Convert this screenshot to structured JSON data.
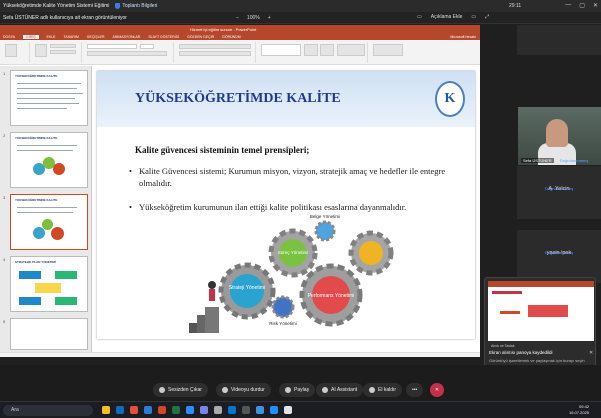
{
  "topbar": {
    "meeting_title": "Yükseköğretimde Kalite Yönetim Sistemi Eğitimi",
    "badge": "Toplantı Bilgileri",
    "clock": "29:11",
    "window_controls": [
      "—",
      "▢",
      "✕"
    ]
  },
  "sharebar": {
    "sharer": "Sefa ÜSTÜNER adlı kullanıcıya ait ekran görüntüleniyor",
    "zoom_minus": "−",
    "zoom_level": "100%",
    "zoom_plus": "+",
    "open_label": "Açıklama Ekle"
  },
  "powerpoint": {
    "window_title": "Hizmet içi eğitim sunum - PowerPoint",
    "tabs": [
      "DOSYA",
      "GİRİŞ",
      "EKLE",
      "TASARIM",
      "GEÇİŞLER",
      "ANİMASYONLAR",
      "SLAYT GÖSTERİSİ",
      "GÖZDEN GEÇİR",
      "GÖRÜNÜM"
    ],
    "user": "Microsoft hesabı"
  },
  "thumbnails": [
    {
      "num": "1",
      "title": "YÜKSEKÖĞRETİMDE KALİTE"
    },
    {
      "num": "2",
      "title": "YÜKSEKÖĞRETİMDE KALİTE"
    },
    {
      "num": "3",
      "title": "YÜKSEKÖĞRETİMDE KALİTE"
    },
    {
      "num": "4",
      "title": "STRATEJİK PLAN YÖNETİMİ"
    },
    {
      "num": "5",
      "title": ""
    }
  ],
  "slide": {
    "title": "YÜKSEKÖĞRETİMDE KALİTE",
    "logo_letter": "K",
    "subtitle": "Kalite güvencesi sisteminin temel prensipleri;",
    "bullet1": "Kalite Güvencesi sistemi; Kurumun misyon, vizyon, stratejik amaç ve hedefler ile entegre olmalıdır.",
    "bullet2": "Yükseköğretim kurumunun ilan ettiği kalite politikası esaslarına dayanmalıdır.",
    "gears": {
      "belge": "Belge Yönetimi",
      "surec": "Süreç Yönetimi",
      "strateji": "Strateji Yönetimi",
      "performans": "Performans Yönetimi",
      "risk": "Risk Yönetimi"
    }
  },
  "participants": {
    "webcam_name": "Sefa ÜSTÜNER",
    "webcam_status": "Doğrulanmamış",
    "tile1_name": "A. Yalcin",
    "tile1_status": "Doğrulanmamış",
    "tile2_name": "yasin ipek",
    "tile2_status": "Doğrulanmamış"
  },
  "popup": {
    "small": "Alıntı ve Taslak",
    "title": "Ekran alıntısı panoya kaydedildi",
    "body": "Görüntüyü işaretlemek ve paylaşmak için burayı seçin"
  },
  "meeting_toolbar": {
    "mute": "Sesizden Çıkar",
    "video": "Videoyu durdur",
    "share": "Paylaş",
    "ai": "AI Assistant",
    "raise": "El kaldır",
    "more": "•••"
  },
  "wintask": {
    "search": "Ara",
    "time": "09:42",
    "date": "16.07.2025"
  }
}
